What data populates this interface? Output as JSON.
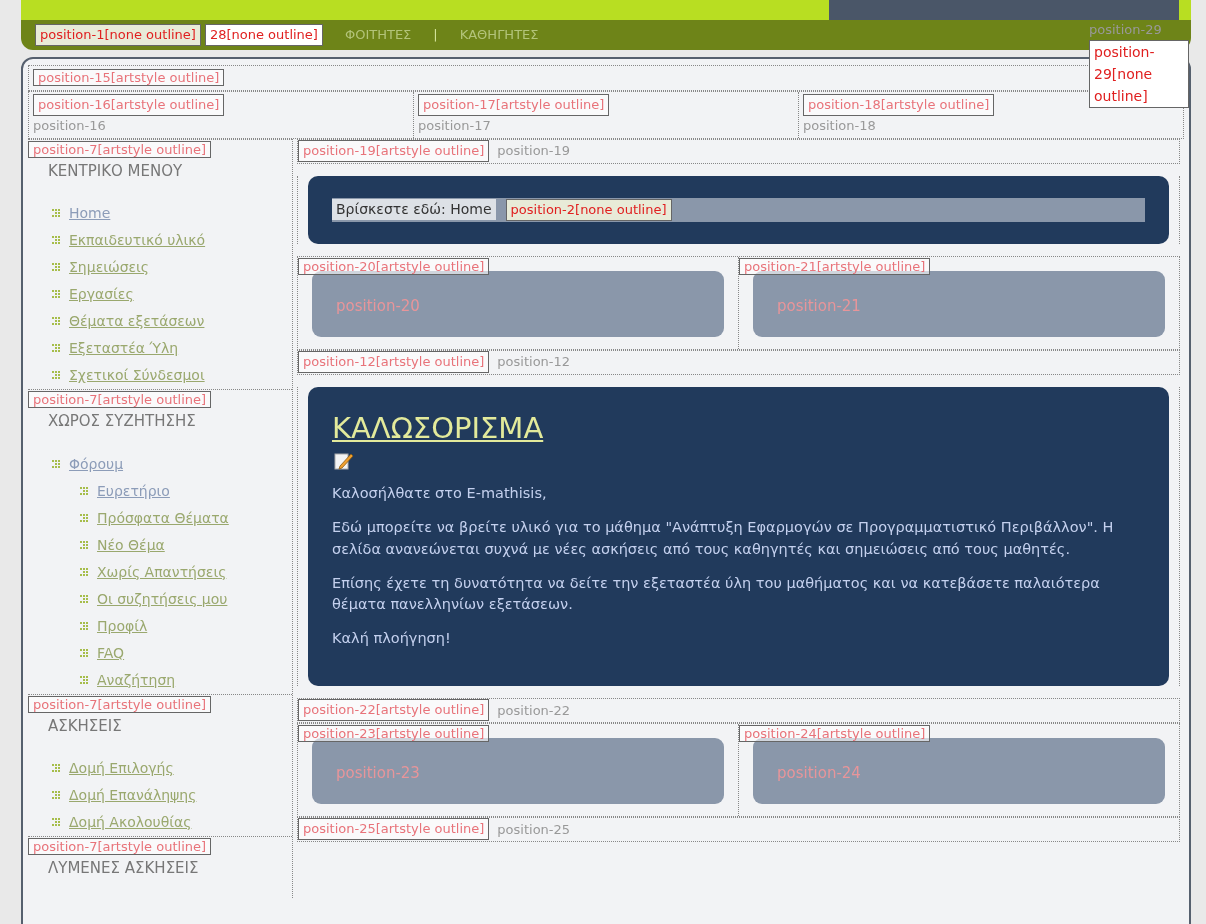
{
  "header": {
    "labels": [
      "position-1[none outline]",
      "28[none outline]"
    ],
    "nav": [
      {
        "label": "ΦΟΙΤΗΤΕΣ",
        "kind": "link"
      },
      {
        "label": "|",
        "kind": "separator"
      },
      {
        "label": "ΚΑΘΗΓΗΤΕΣ",
        "kind": "link"
      }
    ],
    "right": {
      "text": "position-29",
      "label": "position-29[none outline]"
    }
  },
  "top_row": {
    "label": "position-15[artstyle outline]"
  },
  "user_row": [
    {
      "label": "position-16[artstyle outline]",
      "text": "position-16"
    },
    {
      "label": "position-17[artstyle outline]",
      "text": "position-17"
    },
    {
      "label": "position-18[artstyle outline]",
      "text": "position-18"
    }
  ],
  "sidebar": [
    {
      "label": "position-7[artstyle outline]",
      "title": "ΚΕΝΤΡΙΚΟ ΜΕΝΟΥ",
      "items": [
        {
          "label": "Home",
          "visited": true
        },
        {
          "label": "Εκπαιδευτικό υλικό",
          "visited": false
        },
        {
          "label": "Σημειώσεις",
          "visited": false
        },
        {
          "label": "Εργασίες",
          "visited": false
        },
        {
          "label": "Θέματα εξετάσεων",
          "visited": false
        },
        {
          "label": "Εξεταστέα Ύλη",
          "visited": false
        },
        {
          "label": "Σχετικοί Σύνδεσμοι",
          "visited": false
        }
      ]
    },
    {
      "label": "position-7[artstyle outline]",
      "title": "ΧΩΡΟΣ ΣΥΖΗΤΗΣΗΣ",
      "items": [
        {
          "label": "Φόρουμ",
          "visited": true,
          "children": [
            {
              "label": "Ευρετήριο",
              "visited": true
            },
            {
              "label": "Πρόσφατα Θέματα",
              "visited": false
            },
            {
              "label": "Νέο Θέμα",
              "visited": false
            },
            {
              "label": "Χωρίς Απαντήσεις",
              "visited": false
            },
            {
              "label": "Οι συζητήσεις μου",
              "visited": false
            },
            {
              "label": "Προφίλ",
              "visited": false
            },
            {
              "label": "FAQ",
              "visited": false
            },
            {
              "label": "Αναζήτηση",
              "visited": false
            }
          ]
        }
      ]
    },
    {
      "label": "position-7[artstyle outline]",
      "title": "ΑΣΚΗΣΕΙΣ",
      "items": [
        {
          "label": "Δομή Επιλογής",
          "visited": false
        },
        {
          "label": "Δομή Επανάληψης",
          "visited": false
        },
        {
          "label": "Δομή Ακολουθίας",
          "visited": false
        }
      ]
    },
    {
      "label": "position-7[artstyle outline]",
      "title": "ΛΥΜΕΝΕΣ ΑΣΚΗΣΕΙΣ"
    }
  ],
  "content": [
    {
      "kind": "plain",
      "label": "position-19[artstyle outline]",
      "text": "position-19"
    },
    {
      "kind": "breadcrumb",
      "text": "Βρίσκεστε εδώ: Home",
      "label": "position-2[none outline]"
    },
    {
      "kind": "pair",
      "cells": [
        {
          "label": "position-20[artstyle outline]",
          "text": "position-20"
        },
        {
          "label": "position-21[artstyle outline]",
          "text": "position-21"
        }
      ]
    },
    {
      "kind": "plain",
      "label": "position-12[artstyle outline]",
      "text": "position-12"
    },
    {
      "kind": "article",
      "title": "ΚΑΛΩΣΟΡΙΣΜΑ",
      "paragraphs": [
        "Καλοσήλθατε στο E-mathisis,",
        "Εδώ μπορείτε να βρείτε υλικό για το μάθημα \"Ανάπτυξη Εφαρμογών σε Προγραμματιστικό Περιβάλλον\". Η σελίδα ανανεώνεται συχνά με νέες ασκήσεις από τους καθηγητές και σημειώσεις από τους μαθητές.",
        "Επίσης έχετε τη δυνατότητα να δείτε την εξεταστέα ύλη του μαθήματος και να κατεβάσετε παλαιότερα θέματα πανελληνίων εξετάσεων.",
        "Καλή πλοήγηση!"
      ]
    },
    {
      "kind": "plain",
      "label": "position-22[artstyle outline]",
      "text": "position-22"
    },
    {
      "kind": "pair",
      "cells": [
        {
          "label": "position-23[artstyle outline]",
          "text": "position-23"
        },
        {
          "label": "position-24[artstyle outline]",
          "text": "position-24"
        }
      ]
    },
    {
      "kind": "plain",
      "label": "position-25[artstyle outline]",
      "text": "position-25"
    }
  ]
}
